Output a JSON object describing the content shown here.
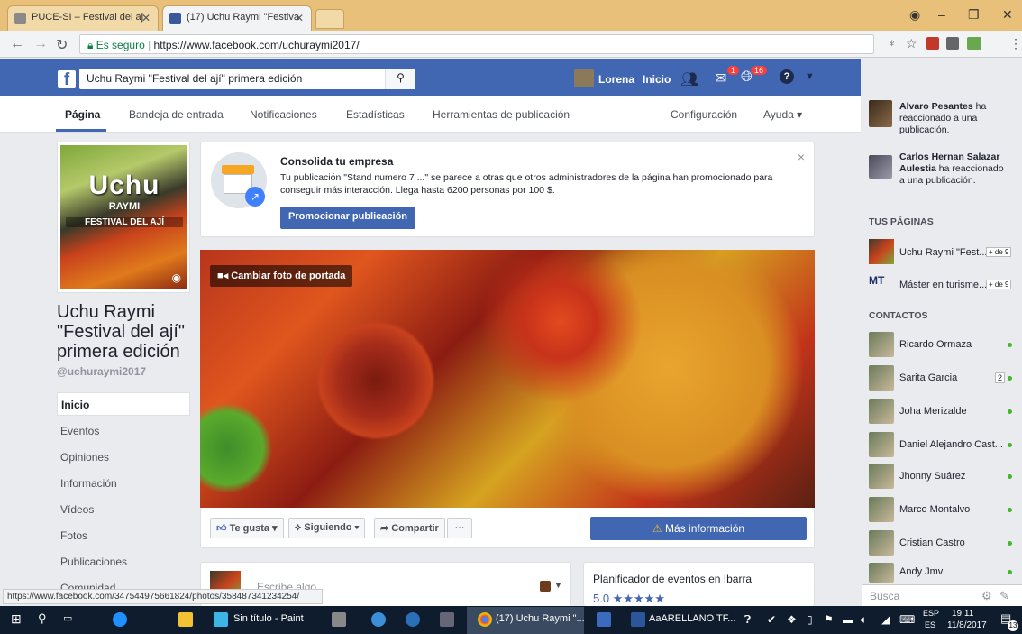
{
  "browser": {
    "tabs": [
      {
        "title": "PUCE-SI – Festival del aj"
      },
      {
        "title": "(17) Uchu Raymi \"Festiva"
      }
    ],
    "secure_label": "Es seguro",
    "url": "https://www.facebook.com/uchuraymi2017/",
    "status_url": "https://www.facebook.com/347544975661824/photos/358487341234254/"
  },
  "fb": {
    "search_value": "Uchu Raymi \"Festival del ají\" primera edición",
    "user": "Lorena",
    "home": "Inicio",
    "friend_badge": "1",
    "notif_badge": "16",
    "brand_color": "#4267b2"
  },
  "page_nav": {
    "items": [
      "Página",
      "Bandeja de entrada",
      "Notificaciones",
      "Estadísticas",
      "Herramientas de publicación"
    ],
    "config": "Configuración",
    "help": "Ayuda ▾"
  },
  "profile": {
    "pic_title_1": "Uchu",
    "pic_title_2": "RAYMI",
    "pic_subtitle": "FESTIVAL DEL AJÍ",
    "name": "Uchu Raymi \"Festival del ají\" primera edición",
    "handle": "@uchuraymi2017"
  },
  "left_nav": [
    "Inicio",
    "Eventos",
    "Opiniones",
    "Información",
    "Vídeos",
    "Fotos",
    "Publicaciones",
    "Comunidad"
  ],
  "promo": {
    "title": "Consolida tu empresa",
    "body": "Tu publicación \"Stand numero 7 ...\" se parece a otras que otros administradores de la página han promocionado para conseguir más interacción. Llega hasta 6200 personas por 100 $.",
    "button": "Promocionar publicación",
    "close": "×"
  },
  "cover": {
    "change_label": "Cambiar foto de portada"
  },
  "actions": {
    "like": "Te gusta ▾",
    "following": "Siguiendo ▾",
    "share": "Compartir",
    "more": "···",
    "more_info": "Más información"
  },
  "composer": {
    "placeholder": "Escribe algo..."
  },
  "event_card": {
    "title": "Planificador de eventos en Ibarra",
    "rating": "5.0 ★★★★★"
  },
  "sidebar": {
    "activity": [
      {
        "name": "Alvaro Pesantes",
        "text": " ha reaccionado a una publicación."
      },
      {
        "name": "Carlos Hernan Salazar Aulestia",
        "text": " ha reaccionado a una publicación."
      }
    ],
    "pages_header": "TUS PÁGINAS",
    "pages": [
      {
        "name": "Uchu Raymi \"Fest...",
        "badge": "+ de 9"
      },
      {
        "name": "Máster en turisme...",
        "badge": "+ de 9"
      }
    ],
    "contacts_header": "CONTACTOS",
    "contacts": [
      {
        "name": "Ricardo Ormaza",
        "count": ""
      },
      {
        "name": "Sarita Garcia",
        "count": "2"
      },
      {
        "name": "Joha Merizalde",
        "count": ""
      },
      {
        "name": "Daniel Alejandro Cast...",
        "count": ""
      },
      {
        "name": "Jhonny Suárez",
        "count": ""
      },
      {
        "name": "Marco Montalvo",
        "count": ""
      },
      {
        "name": "Cristian Castro",
        "count": ""
      },
      {
        "name": "Andy Jmv",
        "count": ""
      }
    ],
    "search_placeholder": "Búsca"
  },
  "taskbar": {
    "apps": [
      "Sin título - Paint",
      "(17) Uchu Raymi \"...",
      "AaARELLANO TF..."
    ],
    "lang_1": "ESP",
    "lang_2": "ES",
    "time": "19:11",
    "date": "11/8/2017",
    "notif_count": "13"
  }
}
